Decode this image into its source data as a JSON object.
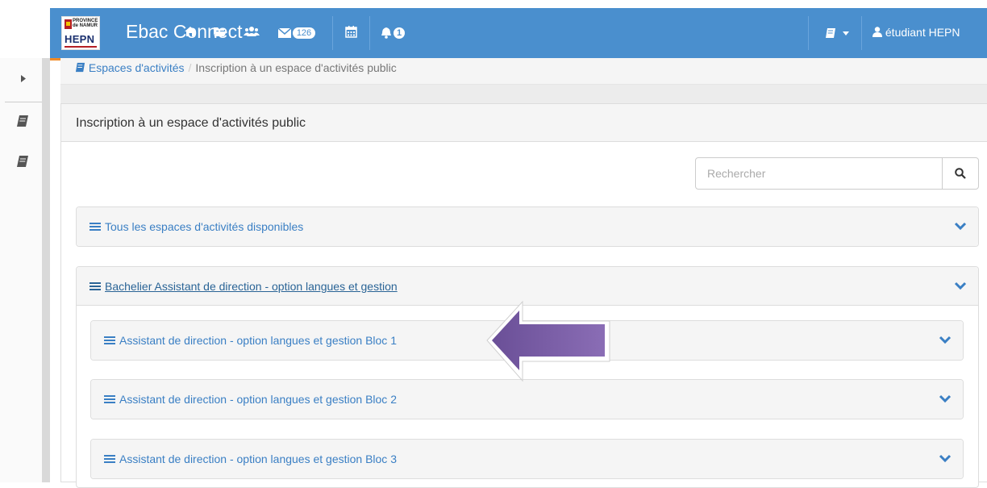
{
  "navbar": {
    "logo": {
      "province_line1": "PROVINCE",
      "province_line2": "de NAMUR",
      "acronym": "HEPN"
    },
    "brand": "Ebac Connect",
    "icons": [
      "home-icon",
      "folder-open-icon",
      "users-icon",
      "envelope-icon",
      "calendar-icon",
      "bell-icon",
      "book-dropdown-icon",
      "user-icon"
    ],
    "messages_count": "126",
    "notifications_count": "1",
    "user_name": "étudiant HEPN",
    "color": "#4a8fce",
    "accent": "#f08a24"
  },
  "breadcrumb": {
    "link": "Espaces d'activités",
    "separator": "/",
    "current": "Inscription à un espace d'activités public"
  },
  "panel": {
    "title": "Inscription à un espace d'activités public",
    "search_placeholder": "Rechercher"
  },
  "groups": [
    {
      "title": "Tous les espaces d'activités disponibles"
    },
    {
      "title": "Bachelier Assistant de direction - option langues et gestion",
      "children": [
        {
          "title": "Assistant de direction - option langues et gestion Bloc 1"
        },
        {
          "title": "Assistant de direction - option langues et gestion Bloc 2"
        },
        {
          "title": "Assistant de direction - option langues et gestion Bloc 3"
        }
      ]
    }
  ],
  "annotation": {
    "arrow_color": "#8065a8"
  }
}
